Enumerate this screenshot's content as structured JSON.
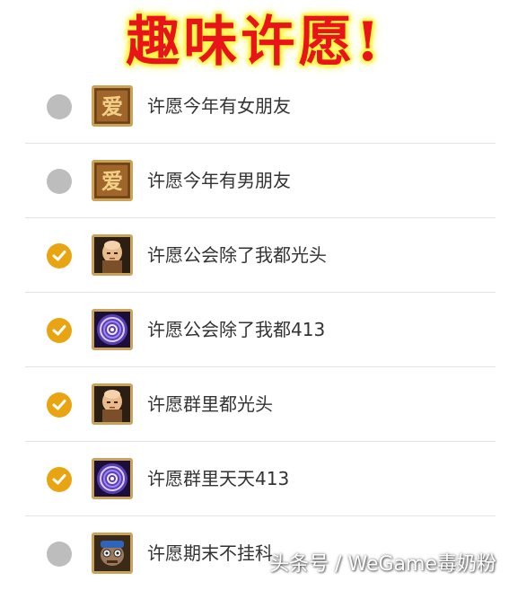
{
  "header": {
    "title": "趣味许愿!"
  },
  "colors": {
    "checked": "#e9a412",
    "unchecked": "#bdbdbd",
    "title_text": "#e8141a",
    "title_glow": "#fff83a"
  },
  "wishes": [
    {
      "label": "许愿今年有女朋友",
      "checked": false,
      "icon": "love-scroll-icon"
    },
    {
      "label": "许愿今年有男朋友",
      "checked": false,
      "icon": "love-scroll-icon"
    },
    {
      "label": "许愿公会除了我都光头",
      "checked": true,
      "icon": "bald-monk-icon"
    },
    {
      "label": "许愿公会除了我都413",
      "checked": true,
      "icon": "purple-vortex-icon"
    },
    {
      "label": "许愿群里都光头",
      "checked": true,
      "icon": "bald-monk-icon"
    },
    {
      "label": "许愿群里天天413",
      "checked": true,
      "icon": "purple-vortex-icon"
    },
    {
      "label": "许愿期末不挂科",
      "checked": false,
      "icon": "scholar-goblin-icon"
    }
  ],
  "watermark": "头条号 / WeGame毒奶粉"
}
